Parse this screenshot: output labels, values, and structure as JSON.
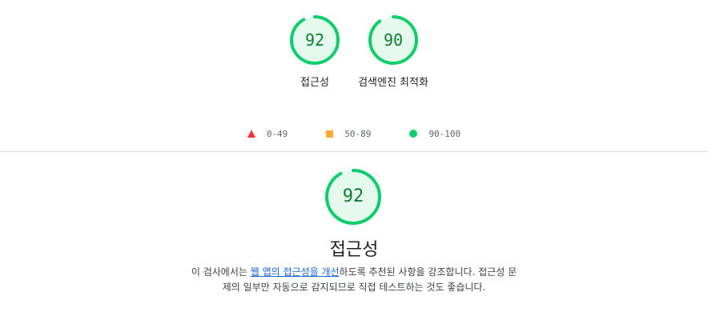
{
  "gauges": [
    {
      "score": "92",
      "label": "접근성",
      "fraction": 0.92
    },
    {
      "score": "90",
      "label": "검색엔진 최적화",
      "fraction": 0.9
    }
  ],
  "legend": [
    {
      "range": "0-49",
      "shape": "triangle",
      "color": "#ff3333"
    },
    {
      "range": "50-89",
      "shape": "square",
      "color": "#ffaa33"
    },
    {
      "range": "90-100",
      "shape": "circle",
      "color": "#0cce6b"
    }
  ],
  "category": {
    "score": "92",
    "fraction": 0.92,
    "title": "접근성",
    "description_before": "이 검사에서는 ",
    "description_link": "웹 앱의 접근성을 개선",
    "description_after": "하도록 추천된 사항을 강조합니다. 접근성 문제의 일부만 자동으로 감지되므로 직접 테스트하는 것도 좋습니다."
  },
  "colors": {
    "pass": "#0cce6b",
    "pass_text": "#0a7d30",
    "pass_fill": "#e6f9ee",
    "link": "#1a66d4"
  }
}
